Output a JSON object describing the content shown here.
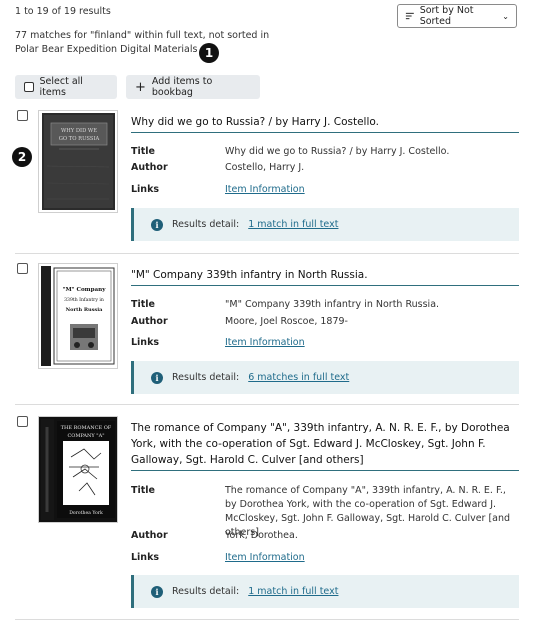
{
  "header": {
    "results_count": "1 to 19 of 19 results",
    "matches_line": "77 matches for \"finland\" within full text, not sorted in",
    "collection": "Polar Bear Expedition Digital Materials",
    "sort_label": "Sort by Not Sorted"
  },
  "callouts": [
    "1",
    "2"
  ],
  "toolbar": {
    "select_all": "Select all items",
    "add_bookbag": "Add items to bookbag"
  },
  "labels": {
    "title": "Title",
    "author": "Author",
    "links": "Links",
    "results_detail": "Results detail:"
  },
  "items": [
    {
      "heading": "Why did we go to Russia? / by Harry J. Costello.",
      "title": "Why did we go to Russia? / by Harry J. Costello.",
      "author": "Costello, Harry J.",
      "link": "Item Information",
      "detail": "1 match in full text",
      "cover_text": "WHY DID WE GO TO RUSSIA"
    },
    {
      "heading": "\"M\" Company 339th infantry in North Russia.",
      "title": "\"M\" Company 339th infantry in North Russia.",
      "author": "Moore, Joel Roscoe, 1879-",
      "link": "Item Information",
      "detail": "6 matches in full text",
      "cover_text": [
        "\"M\" Company",
        "339th Infantry in",
        "North Russia"
      ]
    },
    {
      "heading": "The romance of Company \"A\", 339th infantry, A. N. R. E. F., by Dorothea York, with the co-operation of Sgt. Edward J. McCloskey, Sgt. John F. Galloway, Sgt. Harold C. Culver [and others]",
      "title": "The romance of Company \"A\", 339th infantry, A. N. R. E. F., by Dorothea York, with the co-operation of Sgt. Edward J. McCloskey, Sgt. John F. Galloway, Sgt. Harold C. Culver [and others]",
      "author": "York, Dorothea.",
      "link": "Item Information",
      "detail": "1 match in full text",
      "cover_text": [
        "THE ROMANCE OF",
        "COMPANY \"A\"",
        "Dorothea York"
      ]
    }
  ],
  "colors": {
    "accent": "#2f6f7d",
    "detail_bg": "#e8f1f3",
    "link": "#1f6b8b",
    "button_bg": "#e8ebee"
  }
}
